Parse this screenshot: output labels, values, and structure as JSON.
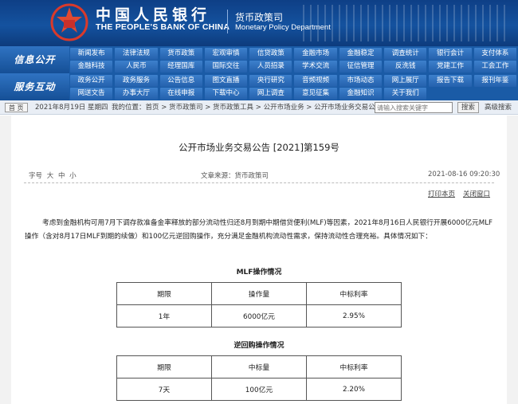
{
  "header": {
    "bank_cn": "中国人民银行",
    "bank_en": "THE PEOPLE'S BANK OF CHINA",
    "dept_cn": "货币政策司",
    "dept_en": "Monetary Policy Department",
    "emblem_icon": "pboc-emblem-icon",
    "colors": {
      "header_bg": "#14529f",
      "nav_bg": "#1a5ba6",
      "nav_item": "#2461ad"
    }
  },
  "nav": {
    "info_title": "信息公开",
    "service_title": "服务互动",
    "info_items": [
      "新闻发布",
      "法律法规",
      "货币政策",
      "宏观审慎",
      "信贷政策",
      "金融市场",
      "金融稳定",
      "调查统计",
      "银行会计",
      "支付体系",
      "金融科技",
      "人民币",
      "经理国库",
      "国际交往",
      "人员招录",
      "学术交流",
      "征信管理",
      "反洗钱",
      "党建工作",
      "工会工作"
    ],
    "service_items": [
      "政务公开",
      "政务服务",
      "公告信息",
      "图文直播",
      "央行研究",
      "音频视频",
      "市场动态",
      "网上展厅",
      "报告下载",
      "报刊年鉴",
      "网送文告",
      "办事大厅",
      "在线申报",
      "下载中心",
      "网上调查",
      "意见征集",
      "金融知识",
      "关于我们",
      "",
      ""
    ]
  },
  "crumbbar": {
    "home_label": "首 页",
    "date": "2021年8月19日 星期四",
    "crumbs": "我的位置：首页 > 货币政策司 > 货币政策工具 > 公开市场业务 > 公开市场业务交易公告",
    "search_placeholder": "请输入搜索关键字",
    "search_label": "搜索",
    "adv_search_label": "高级搜索"
  },
  "article": {
    "title": "公开市场业务交易公告 [2021]第159号",
    "font_size_label": "字号",
    "font_sizes": [
      "大",
      "中",
      "小"
    ],
    "source": "文章来源：货币政策司",
    "pubtime": "2021-08-16 09:20:30",
    "print_label": "打印本页",
    "close_label": "关闭窗口",
    "body": "考虑到金融机构可用7月下调存款准备金率释放的部分流动性归还8月到期中期借贷便利(MLF)等因素，2021年8月16日人民银行开展6000亿元MLF操作（含对8月17日MLF到期的续做）和100亿元逆回购操作，充分满足金融机构流动性需求，保持流动性合理充裕。具体情况如下："
  },
  "mlf_table": {
    "title": "MLF操作情况",
    "headers": [
      "期限",
      "操作量",
      "中标利率"
    ],
    "rows": [
      [
        "1年",
        "6000亿元",
        "2.95%"
      ]
    ]
  },
  "repo_table": {
    "title": "逆回购操作情况",
    "headers": [
      "期限",
      "中标量",
      "中标利率"
    ],
    "rows": [
      [
        "7天",
        "100亿元",
        "2.20%"
      ]
    ]
  }
}
